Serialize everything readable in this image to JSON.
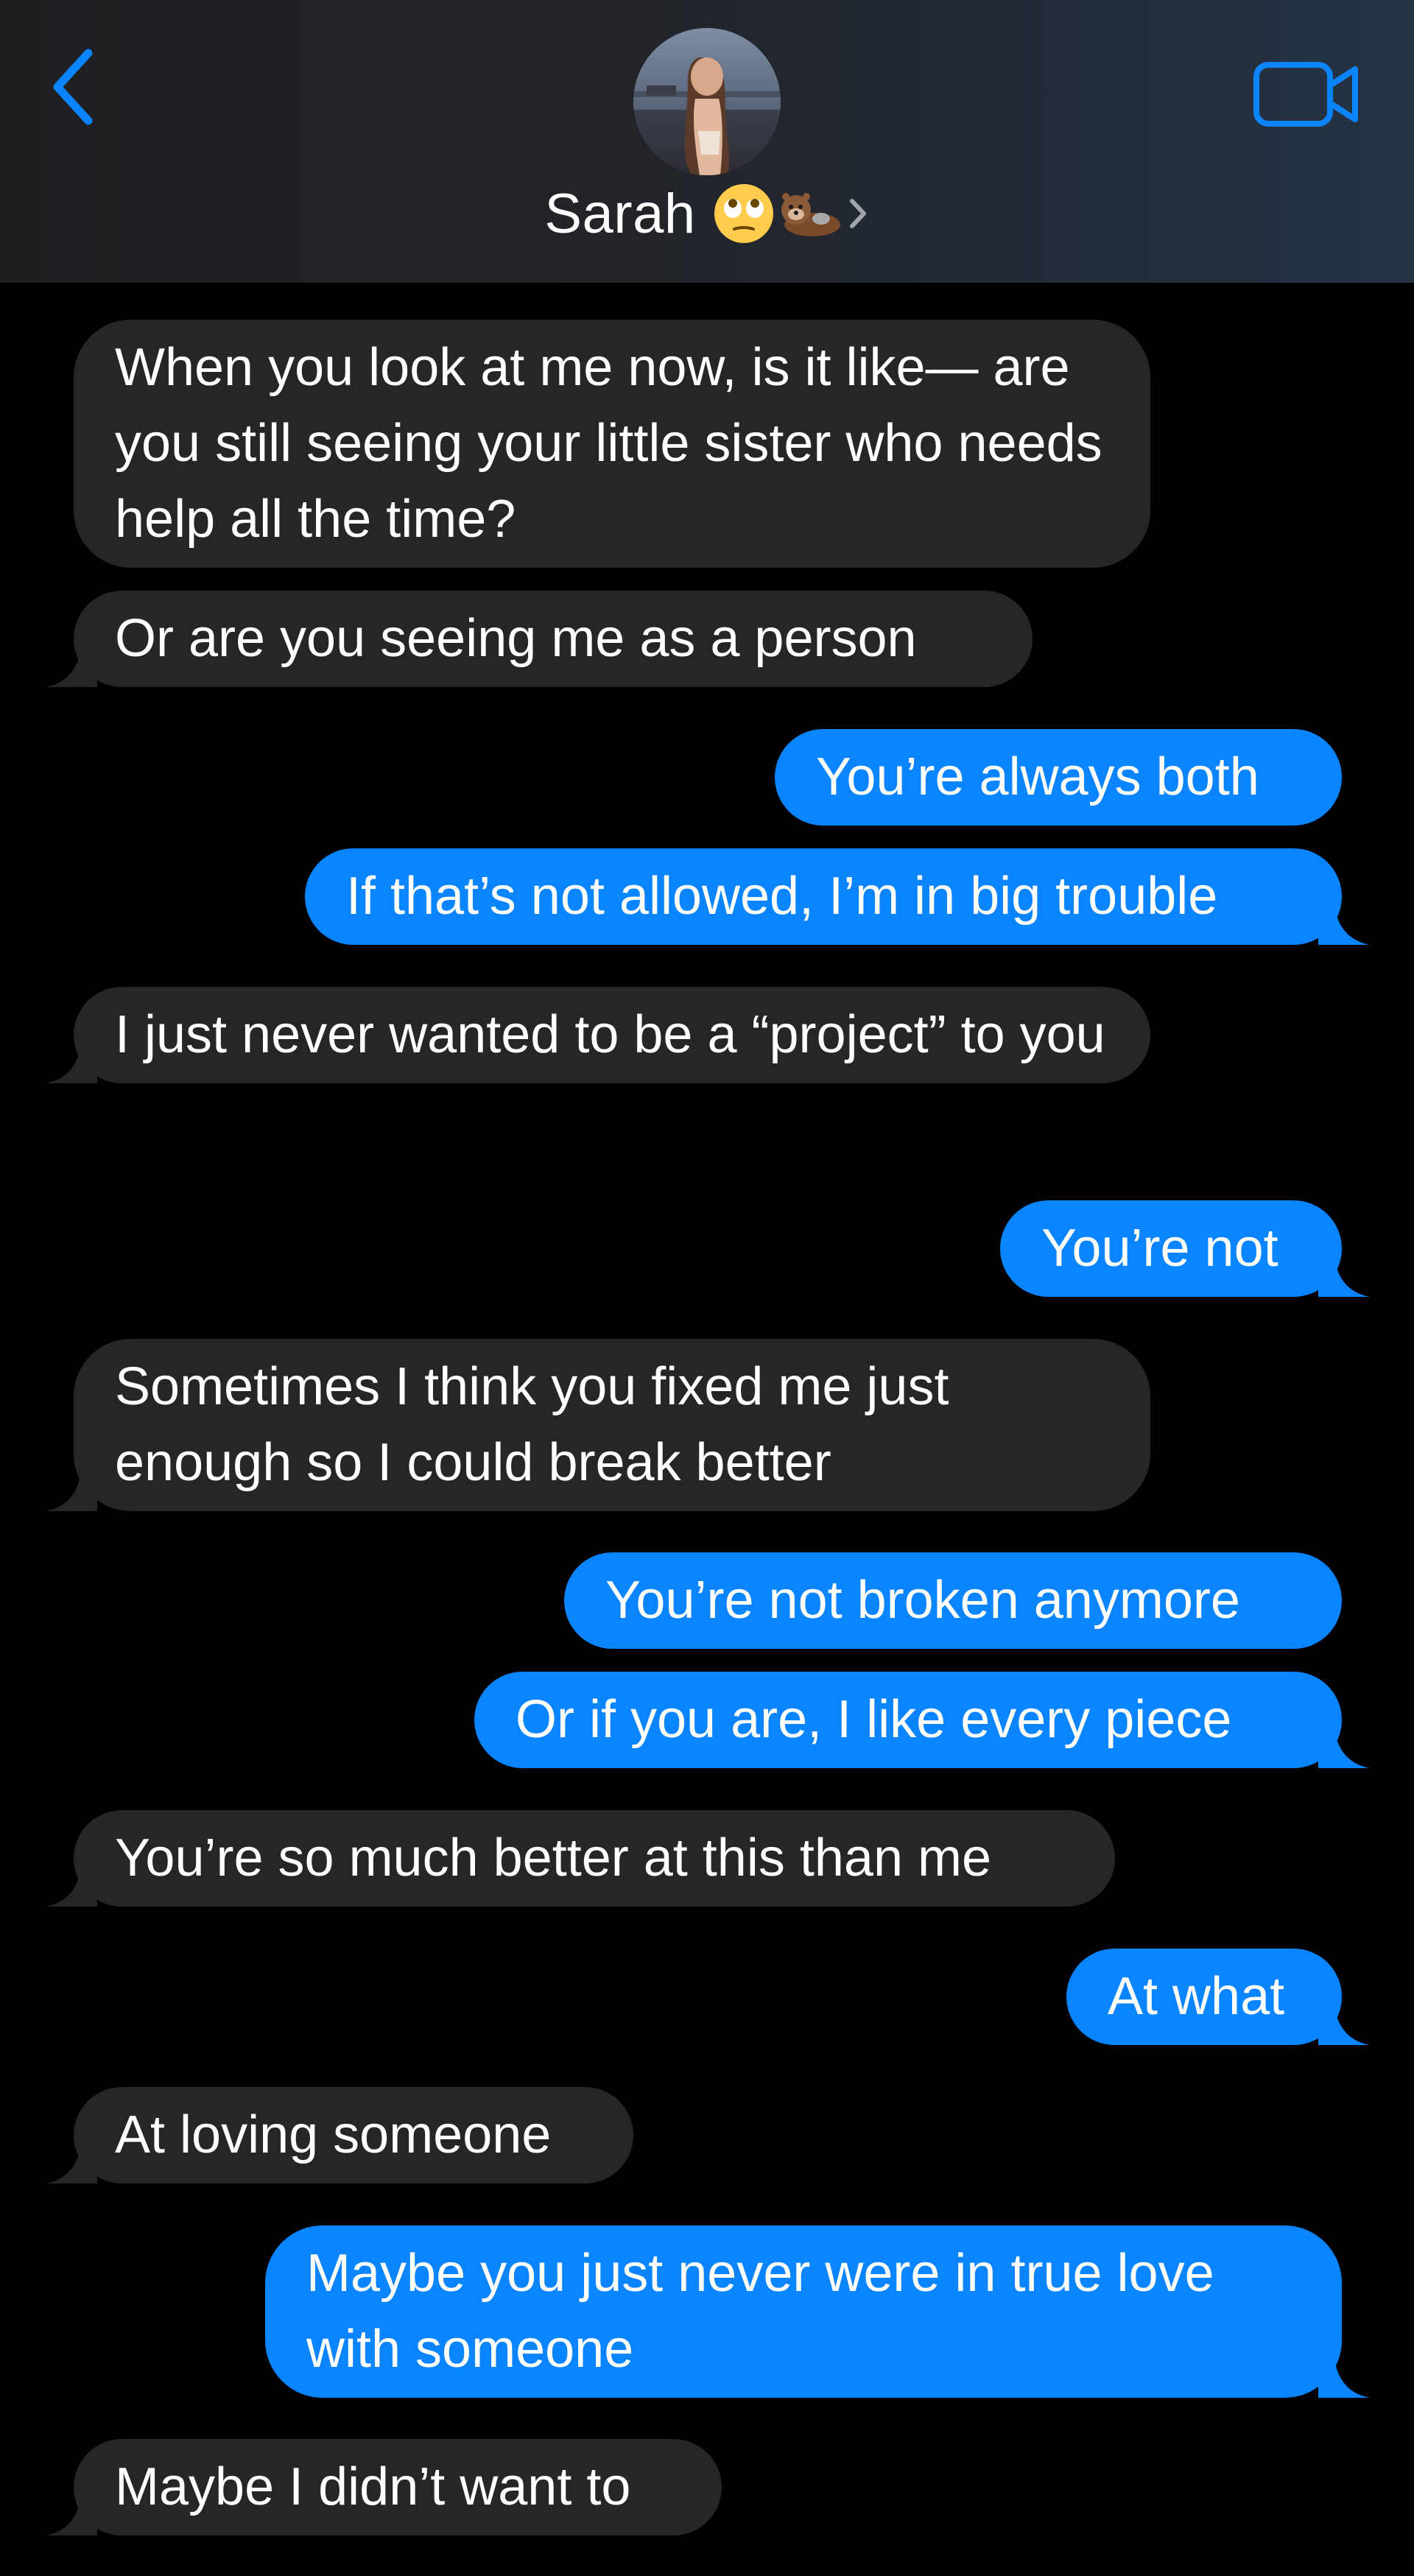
{
  "colors": {
    "incoming_bubble": "#262628",
    "outgoing_bubble": "#0a84ff",
    "accent": "#0a84ff",
    "text": "#ffffff",
    "background": "#000000"
  },
  "header": {
    "back_icon": "chevron-left-icon",
    "contact_name": "Sarah",
    "contact_emoji": "🙄🦦",
    "detail_icon": "chevron-right-icon",
    "video_icon": "video-camera-icon",
    "avatar": "contact-photo"
  },
  "messages": [
    {
      "sender": "them",
      "text": "When you look at me now, is it like— are you still seeing your little sister who needs help all the time?"
    },
    {
      "sender": "them",
      "text": "Or are you seeing me as a person"
    },
    {
      "sender": "me",
      "text": "You’re always both"
    },
    {
      "sender": "me",
      "text": "If that’s not allowed, I’m in big trouble"
    },
    {
      "sender": "them",
      "text": "I just never wanted to be a “project” to you"
    },
    {
      "sender": "me",
      "text": "You’re not"
    },
    {
      "sender": "them",
      "text": "Sometimes I think you fixed me just enough so I could break better"
    },
    {
      "sender": "me",
      "text": "You’re not broken anymore"
    },
    {
      "sender": "me",
      "text": "Or if you are, I like every piece"
    },
    {
      "sender": "them",
      "text": "You’re so much better at this than me"
    },
    {
      "sender": "me",
      "text": "At what"
    },
    {
      "sender": "them",
      "text": "At loving someone"
    },
    {
      "sender": "me",
      "text": "Maybe you just never were in true love with someone"
    },
    {
      "sender": "them",
      "text": "Maybe I didn’t want to"
    }
  ]
}
